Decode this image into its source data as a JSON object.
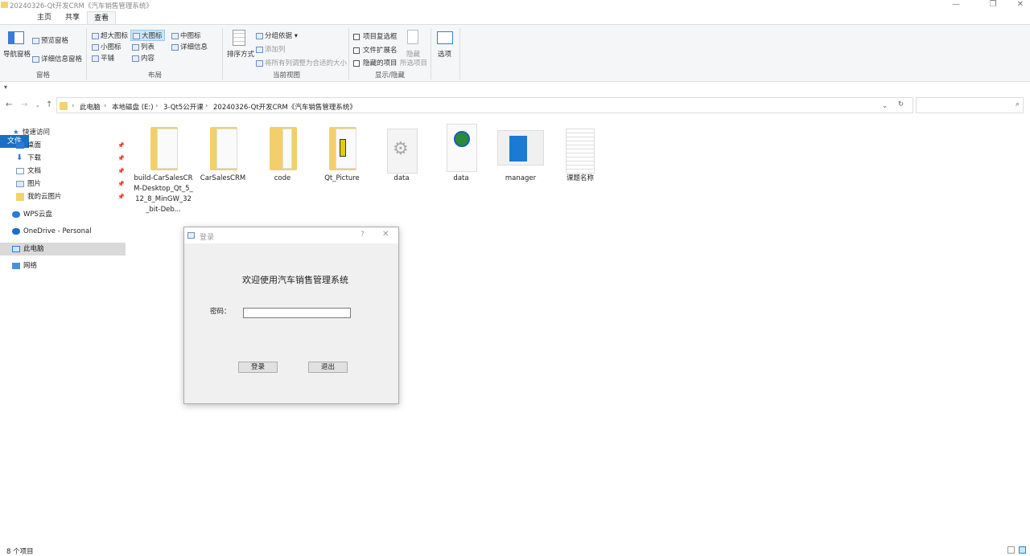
{
  "window": {
    "title": "20240326-Qt开发CRM《汽车销售管理系统》",
    "minimize": "—",
    "maximize": "❐",
    "close": "✕"
  },
  "tabs": [
    "文件",
    "主页",
    "共享",
    "查看"
  ],
  "ribbon": {
    "pane": {
      "nav_pane": "导航窗格",
      "preview": "预览窗格",
      "details": "详细信息窗格",
      "group": "窗格"
    },
    "layout": {
      "items": [
        "超大图标",
        "大图标",
        "中图标",
        "小图标",
        "列表",
        "详细信息",
        "平铺",
        "内容"
      ],
      "group": "布局"
    },
    "view": {
      "sort": "排序方式",
      "group_by": "分组依据",
      "add_col": "添加列",
      "fit_cols": "将所有列调整为合适的大小",
      "group": "当前视图"
    },
    "show": {
      "checkboxes": "项目复选框",
      "extensions": "文件扩展名",
      "hidden": "隐藏的项目",
      "hide": "隐藏",
      "selected": "所选项目",
      "group": "显示/隐藏"
    },
    "options": "选项"
  },
  "address": {
    "crumbs": [
      "此电脑",
      "本地磁盘 (E:)",
      "3-Qt5公开课",
      "20240326-Qt开发CRM《汽车销售管理系统》"
    ]
  },
  "sidebar": [
    {
      "label": "快速访问"
    },
    {
      "label": "桌面"
    },
    {
      "label": "下载"
    },
    {
      "label": "文档"
    },
    {
      "label": "图片"
    },
    {
      "label": "我的云图片"
    },
    {
      "label": "WPS云盘"
    },
    {
      "label": "OneDrive - Personal"
    },
    {
      "label": "此电脑"
    },
    {
      "label": "网络"
    }
  ],
  "files": [
    {
      "name": "build-CarSalesCRM-Desktop_Qt_5_12_8_MinGW_32_bit-Deb...",
      "type": "folder"
    },
    {
      "name": "CarSalesCRM",
      "type": "folder"
    },
    {
      "name": "code",
      "type": "folder"
    },
    {
      "name": "Qt_Picture",
      "type": "folder"
    },
    {
      "name": "data",
      "type": "settings"
    },
    {
      "name": "data",
      "type": "web"
    },
    {
      "name": "manager",
      "type": "app"
    },
    {
      "name": "课题名称",
      "type": "text"
    }
  ],
  "dialog": {
    "title": "登录",
    "help": "?",
    "close": "✕",
    "heading": "欢迎使用汽车销售管理系统",
    "password_label": "密码：",
    "password_value": "",
    "login": "登录",
    "exit": "退出"
  },
  "status": {
    "count": "8 个项目"
  }
}
